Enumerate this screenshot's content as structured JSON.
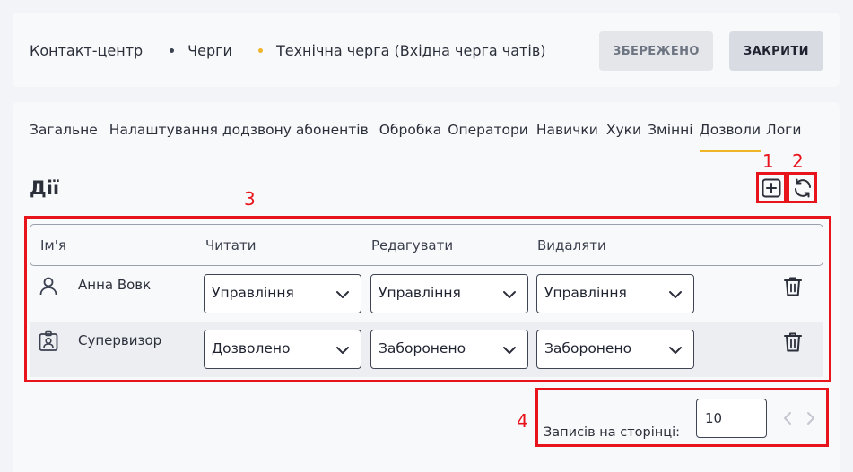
{
  "header": {
    "breadcrumbs": [
      "Контакт-центр",
      "Черги",
      "Технічна черга (Вхідна черга чатів)"
    ],
    "saved_label": "ЗБЕРЕЖЕНО",
    "close_label": "ЗАКРИТИ"
  },
  "tabs": [
    {
      "label": "Загальне"
    },
    {
      "label": "Налаштування додзвону абонентів"
    },
    {
      "label": "Обробка"
    },
    {
      "label": "Оператори"
    },
    {
      "label": "Навички"
    },
    {
      "label": "Хуки"
    },
    {
      "label": "Змінні"
    },
    {
      "label": "Дозволи",
      "active": true
    },
    {
      "label": "Логи"
    }
  ],
  "section": {
    "title": "Дії",
    "add_icon": "plus-square-icon",
    "refresh_icon": "refresh-icon"
  },
  "table": {
    "columns": [
      "Ім'я",
      "Читати",
      "Редагувати",
      "Видаляти"
    ],
    "rows": [
      {
        "icon": "user-icon",
        "name": "Анна Вовк",
        "read": "Управління",
        "edit": "Управління",
        "delete": "Управління"
      },
      {
        "icon": "badge-icon",
        "name": "Супервизор",
        "read": "Дозволено",
        "edit": "Заборонено",
        "delete": "Заборонено"
      }
    ]
  },
  "pagination": {
    "label": "Записів на сторінці:",
    "page_size": "10"
  },
  "annotations": [
    "1",
    "2",
    "3",
    "4"
  ],
  "colors": {
    "accent": "#f0b429",
    "annotation_red": "#e8141c"
  }
}
